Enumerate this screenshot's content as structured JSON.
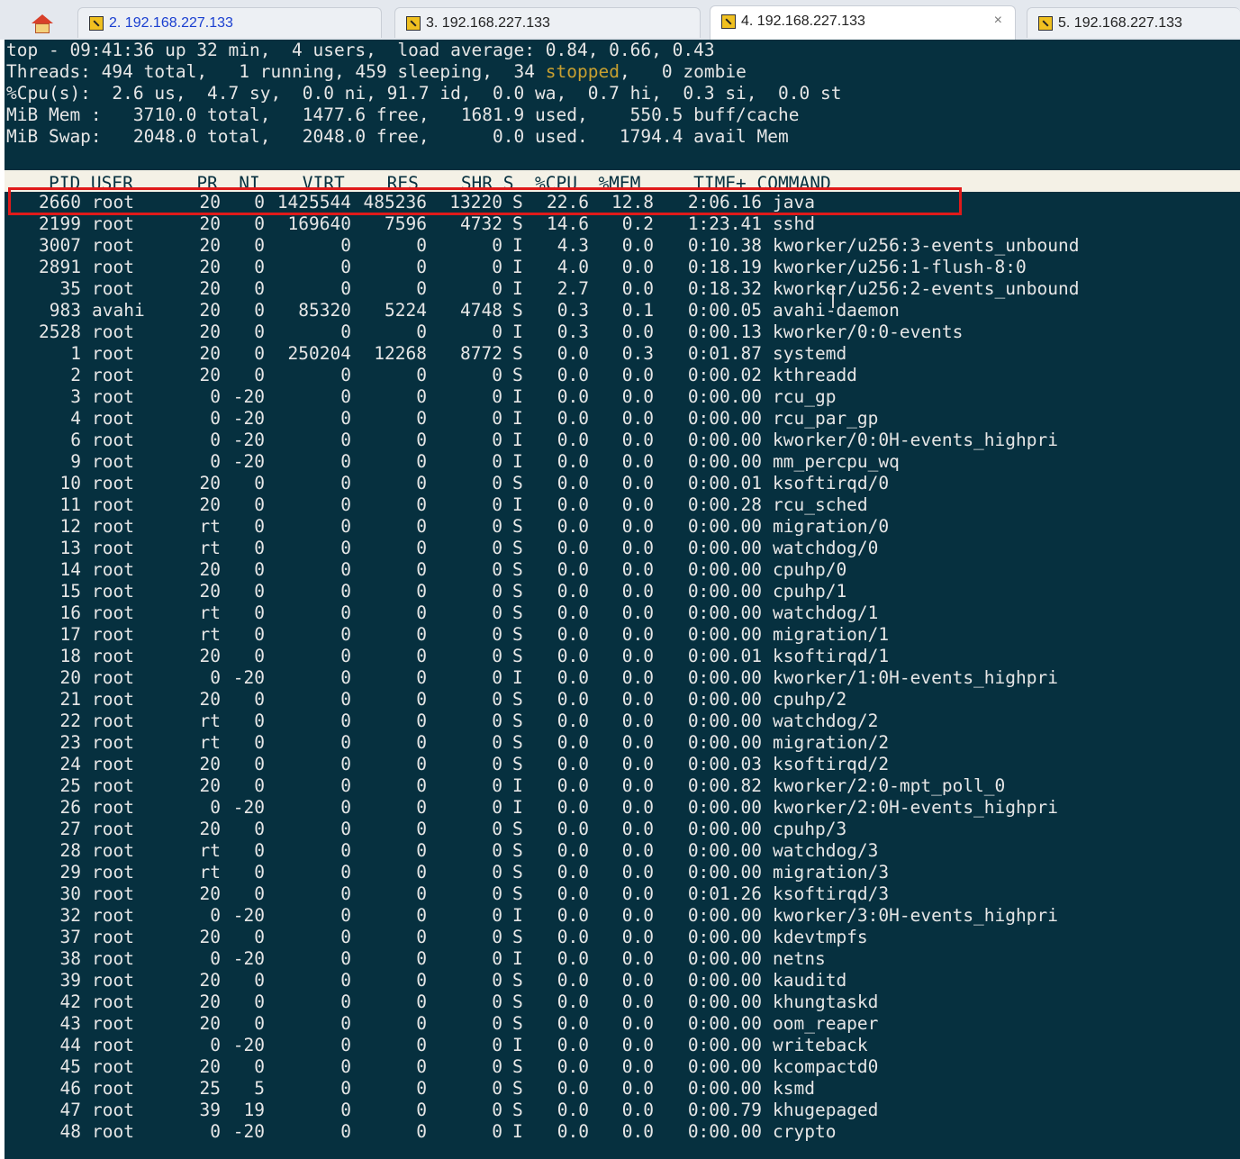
{
  "tabs": [
    {
      "label": "2. 192.168.227.133",
      "active": false
    },
    {
      "label": "3. 192.168.227.133",
      "active": false
    },
    {
      "label": "4. 192.168.227.133",
      "active": true
    },
    {
      "label": "5. 192.168.227.133",
      "active": false
    }
  ],
  "tab_close": "×",
  "summary": {
    "line1": "top - 09:41:36 up 32 min,  4 users,  load average: 0.84, 0.66, 0.43",
    "line2_a": "Threads: 494 total,   1 running, 459 sleeping,  34 ",
    "line2_stopped": "stopped",
    "line2_b": ",   0 zombie",
    "line3": "%Cpu(s):  2.6 us,  4.7 sy,  0.0 ni, 91.7 id,  0.0 wa,  0.7 hi,  0.3 si,  0.0 st",
    "line4": "MiB Mem :   3710.0 total,   1477.6 free,   1681.9 used,    550.5 buff/cache",
    "line5": "MiB Swap:   2048.0 total,   2048.0 free,      0.0 used.   1794.4 avail Mem"
  },
  "columns": "    PID USER      PR  NI    VIRT    RES    SHR S  %CPU  %MEM     TIME+ COMMAND",
  "rows": [
    [
      "2660",
      "root",
      "20",
      "0",
      "1425544",
      "485236",
      "13220",
      "S",
      "22.6",
      "12.8",
      "2:06.16",
      "java"
    ],
    [
      "2199",
      "root",
      "20",
      "0",
      "169640",
      "7596",
      "4732",
      "S",
      "14.6",
      "0.2",
      "1:23.41",
      "sshd"
    ],
    [
      "3007",
      "root",
      "20",
      "0",
      "0",
      "0",
      "0",
      "I",
      "4.3",
      "0.0",
      "0:10.38",
      "kworker/u256:3-events_unbound"
    ],
    [
      "2891",
      "root",
      "20",
      "0",
      "0",
      "0",
      "0",
      "I",
      "4.0",
      "0.0",
      "0:18.19",
      "kworker/u256:1-flush-8:0"
    ],
    [
      "35",
      "root",
      "20",
      "0",
      "0",
      "0",
      "0",
      "I",
      "2.7",
      "0.0",
      "0:18.32",
      "kworker/u256:2-events_unbound"
    ],
    [
      "983",
      "avahi",
      "20",
      "0",
      "85320",
      "5224",
      "4748",
      "S",
      "0.3",
      "0.1",
      "0:00.05",
      "avahi-daemon"
    ],
    [
      "2528",
      "root",
      "20",
      "0",
      "0",
      "0",
      "0",
      "I",
      "0.3",
      "0.0",
      "0:00.13",
      "kworker/0:0-events"
    ],
    [
      "1",
      "root",
      "20",
      "0",
      "250204",
      "12268",
      "8772",
      "S",
      "0.0",
      "0.3",
      "0:01.87",
      "systemd"
    ],
    [
      "2",
      "root",
      "20",
      "0",
      "0",
      "0",
      "0",
      "S",
      "0.0",
      "0.0",
      "0:00.02",
      "kthreadd"
    ],
    [
      "3",
      "root",
      "0",
      "-20",
      "0",
      "0",
      "0",
      "I",
      "0.0",
      "0.0",
      "0:00.00",
      "rcu_gp"
    ],
    [
      "4",
      "root",
      "0",
      "-20",
      "0",
      "0",
      "0",
      "I",
      "0.0",
      "0.0",
      "0:00.00",
      "rcu_par_gp"
    ],
    [
      "6",
      "root",
      "0",
      "-20",
      "0",
      "0",
      "0",
      "I",
      "0.0",
      "0.0",
      "0:00.00",
      "kworker/0:0H-events_highpri"
    ],
    [
      "9",
      "root",
      "0",
      "-20",
      "0",
      "0",
      "0",
      "I",
      "0.0",
      "0.0",
      "0:00.00",
      "mm_percpu_wq"
    ],
    [
      "10",
      "root",
      "20",
      "0",
      "0",
      "0",
      "0",
      "S",
      "0.0",
      "0.0",
      "0:00.01",
      "ksoftirqd/0"
    ],
    [
      "11",
      "root",
      "20",
      "0",
      "0",
      "0",
      "0",
      "I",
      "0.0",
      "0.0",
      "0:00.28",
      "rcu_sched"
    ],
    [
      "12",
      "root",
      "rt",
      "0",
      "0",
      "0",
      "0",
      "S",
      "0.0",
      "0.0",
      "0:00.00",
      "migration/0"
    ],
    [
      "13",
      "root",
      "rt",
      "0",
      "0",
      "0",
      "0",
      "S",
      "0.0",
      "0.0",
      "0:00.00",
      "watchdog/0"
    ],
    [
      "14",
      "root",
      "20",
      "0",
      "0",
      "0",
      "0",
      "S",
      "0.0",
      "0.0",
      "0:00.00",
      "cpuhp/0"
    ],
    [
      "15",
      "root",
      "20",
      "0",
      "0",
      "0",
      "0",
      "S",
      "0.0",
      "0.0",
      "0:00.00",
      "cpuhp/1"
    ],
    [
      "16",
      "root",
      "rt",
      "0",
      "0",
      "0",
      "0",
      "S",
      "0.0",
      "0.0",
      "0:00.00",
      "watchdog/1"
    ],
    [
      "17",
      "root",
      "rt",
      "0",
      "0",
      "0",
      "0",
      "S",
      "0.0",
      "0.0",
      "0:00.00",
      "migration/1"
    ],
    [
      "18",
      "root",
      "20",
      "0",
      "0",
      "0",
      "0",
      "S",
      "0.0",
      "0.0",
      "0:00.01",
      "ksoftirqd/1"
    ],
    [
      "20",
      "root",
      "0",
      "-20",
      "0",
      "0",
      "0",
      "I",
      "0.0",
      "0.0",
      "0:00.00",
      "kworker/1:0H-events_highpri"
    ],
    [
      "21",
      "root",
      "20",
      "0",
      "0",
      "0",
      "0",
      "S",
      "0.0",
      "0.0",
      "0:00.00",
      "cpuhp/2"
    ],
    [
      "22",
      "root",
      "rt",
      "0",
      "0",
      "0",
      "0",
      "S",
      "0.0",
      "0.0",
      "0:00.00",
      "watchdog/2"
    ],
    [
      "23",
      "root",
      "rt",
      "0",
      "0",
      "0",
      "0",
      "S",
      "0.0",
      "0.0",
      "0:00.00",
      "migration/2"
    ],
    [
      "24",
      "root",
      "20",
      "0",
      "0",
      "0",
      "0",
      "S",
      "0.0",
      "0.0",
      "0:00.03",
      "ksoftirqd/2"
    ],
    [
      "25",
      "root",
      "20",
      "0",
      "0",
      "0",
      "0",
      "I",
      "0.0",
      "0.0",
      "0:00.82",
      "kworker/2:0-mpt_poll_0"
    ],
    [
      "26",
      "root",
      "0",
      "-20",
      "0",
      "0",
      "0",
      "I",
      "0.0",
      "0.0",
      "0:00.00",
      "kworker/2:0H-events_highpri"
    ],
    [
      "27",
      "root",
      "20",
      "0",
      "0",
      "0",
      "0",
      "S",
      "0.0",
      "0.0",
      "0:00.00",
      "cpuhp/3"
    ],
    [
      "28",
      "root",
      "rt",
      "0",
      "0",
      "0",
      "0",
      "S",
      "0.0",
      "0.0",
      "0:00.00",
      "watchdog/3"
    ],
    [
      "29",
      "root",
      "rt",
      "0",
      "0",
      "0",
      "0",
      "S",
      "0.0",
      "0.0",
      "0:00.00",
      "migration/3"
    ],
    [
      "30",
      "root",
      "20",
      "0",
      "0",
      "0",
      "0",
      "S",
      "0.0",
      "0.0",
      "0:01.26",
      "ksoftirqd/3"
    ],
    [
      "32",
      "root",
      "0",
      "-20",
      "0",
      "0",
      "0",
      "I",
      "0.0",
      "0.0",
      "0:00.00",
      "kworker/3:0H-events_highpri"
    ],
    [
      "37",
      "root",
      "20",
      "0",
      "0",
      "0",
      "0",
      "S",
      "0.0",
      "0.0",
      "0:00.00",
      "kdevtmpfs"
    ],
    [
      "38",
      "root",
      "0",
      "-20",
      "0",
      "0",
      "0",
      "I",
      "0.0",
      "0.0",
      "0:00.00",
      "netns"
    ],
    [
      "39",
      "root",
      "20",
      "0",
      "0",
      "0",
      "0",
      "S",
      "0.0",
      "0.0",
      "0:00.00",
      "kauditd"
    ],
    [
      "42",
      "root",
      "20",
      "0",
      "0",
      "0",
      "0",
      "S",
      "0.0",
      "0.0",
      "0:00.00",
      "khungtaskd"
    ],
    [
      "43",
      "root",
      "20",
      "0",
      "0",
      "0",
      "0",
      "S",
      "0.0",
      "0.0",
      "0:00.00",
      "oom_reaper"
    ],
    [
      "44",
      "root",
      "0",
      "-20",
      "0",
      "0",
      "0",
      "I",
      "0.0",
      "0.0",
      "0:00.00",
      "writeback"
    ],
    [
      "45",
      "root",
      "20",
      "0",
      "0",
      "0",
      "0",
      "S",
      "0.0",
      "0.0",
      "0:00.00",
      "kcompactd0"
    ],
    [
      "46",
      "root",
      "25",
      "5",
      "0",
      "0",
      "0",
      "S",
      "0.0",
      "0.0",
      "0:00.00",
      "ksmd"
    ],
    [
      "47",
      "root",
      "39",
      "19",
      "0",
      "0",
      "0",
      "S",
      "0.0",
      "0.0",
      "0:00.79",
      "khugepaged"
    ],
    [
      "48",
      "root",
      "0",
      "-20",
      "0",
      "0",
      "0",
      "I",
      "0.0",
      "0.0",
      "0:00.00",
      "crypto"
    ]
  ],
  "colors": {
    "terminal_bg": "#06303f",
    "highlight_border": "#e01a1a",
    "stopped": "#c8a030"
  }
}
